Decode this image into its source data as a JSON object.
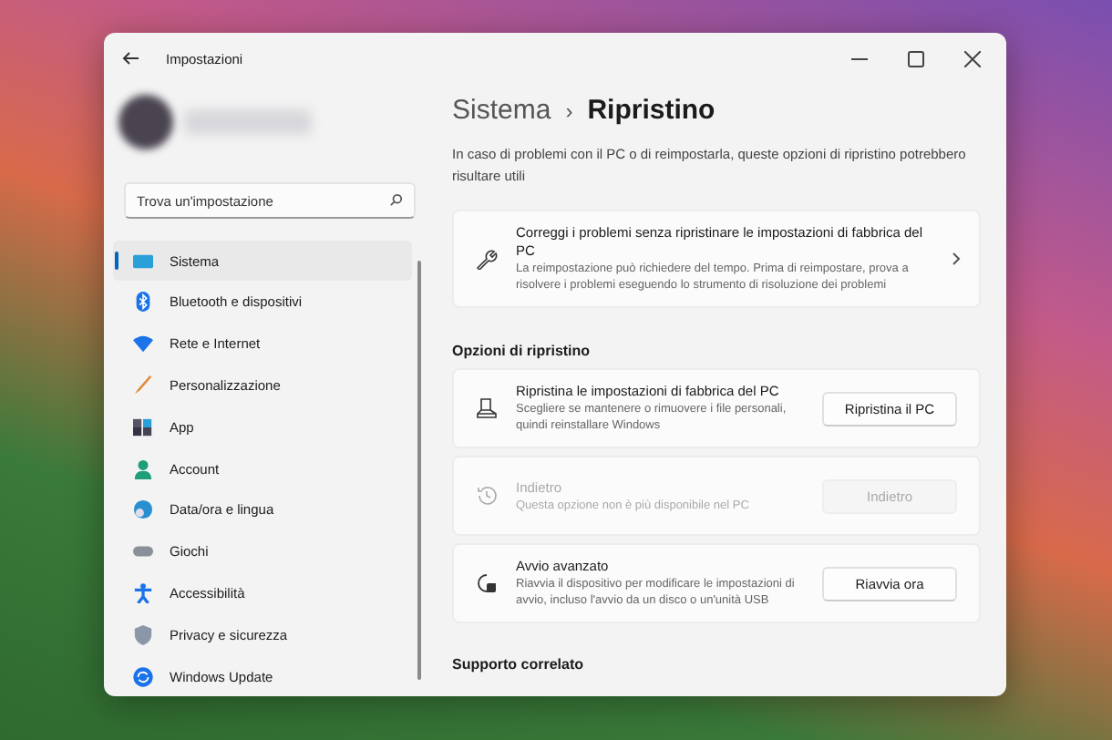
{
  "window": {
    "title": "Impostazioni"
  },
  "search": {
    "placeholder": "Trova un'impostazione"
  },
  "sidebar": {
    "items": [
      {
        "label": "Sistema",
        "selected": true
      },
      {
        "label": "Bluetooth e dispositivi",
        "selected": false
      },
      {
        "label": "Rete e Internet",
        "selected": false
      },
      {
        "label": "Personalizzazione",
        "selected": false
      },
      {
        "label": "App",
        "selected": false
      },
      {
        "label": "Account",
        "selected": false
      },
      {
        "label": "Data/ora e lingua",
        "selected": false
      },
      {
        "label": "Giochi",
        "selected": false
      },
      {
        "label": "Accessibilità",
        "selected": false
      },
      {
        "label": "Privacy e sicurezza",
        "selected": false
      },
      {
        "label": "Windows Update",
        "selected": false
      }
    ]
  },
  "breadcrumb": {
    "parent": "Sistema",
    "separator": "›",
    "current": "Ripristino"
  },
  "intro": "In caso di problemi con il PC o di reimpostarla, queste opzioni di ripristino potrebbero risultare utili",
  "fix_card": {
    "title": "Correggi i problemi senza ripristinare le impostazioni di fabbrica del PC",
    "description": "La reimpostazione può richiedere del tempo. Prima di reimpostare, prova a risolvere i problemi eseguendo lo strumento di risoluzione dei problemi"
  },
  "section": "Opzioni di ripristino",
  "options": [
    {
      "title": "Ripristina le impostazioni di fabbrica del PC",
      "description": "Scegliere se mantenere o rimuovere i file personali, quindi reinstallare Windows",
      "button": "Ripristina il PC",
      "disabled": false
    },
    {
      "title": "Indietro",
      "description": "Questa opzione non è più disponibile nel PC",
      "button": "Indietro",
      "disabled": true
    },
    {
      "title": "Avvio avanzato",
      "description": "Riavvia il dispositivo per modificare le impostazioni di avvio, incluso l'avvio da un disco o un'unità USB",
      "button": "Riavvia ora",
      "disabled": false
    }
  ],
  "related_heading": "Supporto correlato"
}
